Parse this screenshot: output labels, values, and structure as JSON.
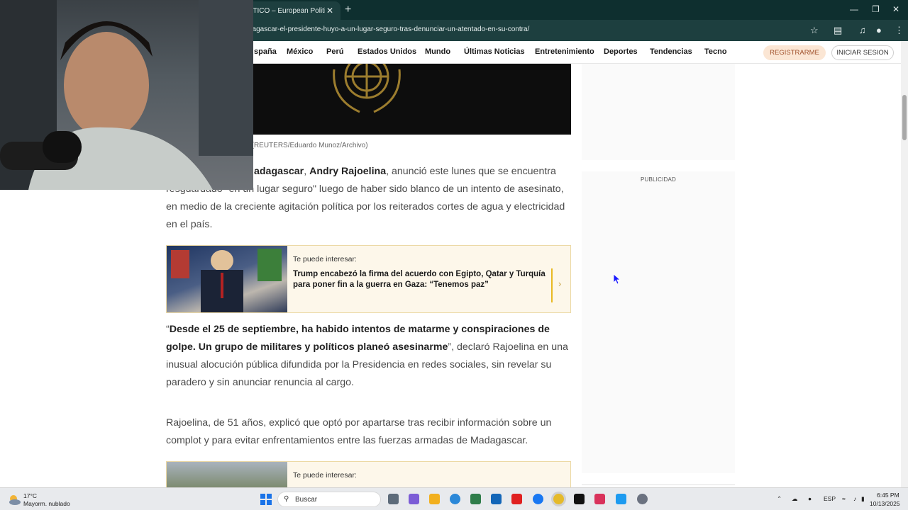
{
  "browser": {
    "tab_title": "LITICO – European Politics, P",
    "tab_close": "✕",
    "new_tab": "+",
    "url": "dagascar-el-presidente-huyo-a-un-lugar-seguro-tras-denunciar-un-atentado-en-su-contra/"
  },
  "nav": {
    "items": [
      "spaña",
      "México",
      "Perú",
      "Estados Unidos",
      "Mundo",
      "Últimas Noticias",
      "Entretenimiento",
      "Deportes",
      "Tendencias",
      "Tecno"
    ],
    "register": "REGISTRARME",
    "login": "INICIAR SESION"
  },
  "article": {
    "caption": "car, Andry Nirina Rajoelina (REUTERS/Eduardo Munoz/Archivo)",
    "p1": {
      "bold1": "adagascar",
      "sep": ", ",
      "bold2": "Andry Rajoelina",
      "rest_line1": ", anunció este lunes que se encuentra",
      "line2": "resguardado \"en un lugar seguro\" luego de haber sido blanco de un intento de asesinato,",
      "line3": "en medio de la creciente agitación política por los reiterados cortes de agua y electricidad",
      "line4": "en el país."
    },
    "p2": {
      "open_quote": "“",
      "bold": "Desde el 25 de septiembre, ha habido intentos de matarme y conspiraciones de golpe. Un grupo de militares y políticos planeó asesinarme",
      "rest": "”, declaró Rajoelina en una inusual alocución pública difundida por la Presidencia en redes sociales, sin revelar su paradero y sin anunciar renuncia al cargo."
    },
    "p3": "Rajoelina, de 51 años, explicó que optó por apartarse tras recibir información sobre un complot y para evitar enfrentamientos entre las fuerzas armadas de Madagascar."
  },
  "related": [
    {
      "kicker": "Te puede interesar:",
      "title": "Trump encabezó la firma del acuerdo con Egipto, Qatar y Turquía para poner fin a la guerra en Gaza: “Tenemos paz”",
      "chevron": "›"
    },
    {
      "kicker": "Te puede interesar:"
    }
  ],
  "sidebar": {
    "ad_label": "PUBLICIDAD"
  },
  "taskbar": {
    "weather_temp": "17°C",
    "weather_desc": "Mayorm. nublado",
    "search_placeholder": "Buscar",
    "lang": "ESP",
    "time": "6:45 PM",
    "date": "10/13/2025"
  },
  "colors": {
    "chrome_dark": "#0e2f2f",
    "register_bg": "#fbe6d4",
    "related_bg": "#fdf7ea",
    "related_accent": "#e8b923"
  }
}
